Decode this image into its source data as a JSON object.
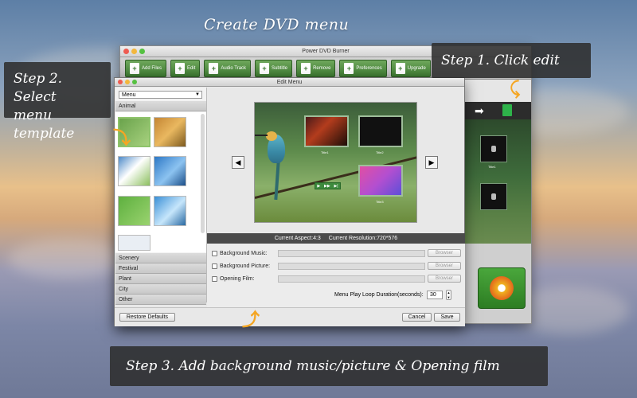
{
  "headline": "Create DVD menu",
  "callouts": {
    "step1": "Step 1. Click edit",
    "step2_line1": "Step 2. Select",
    "step2_line2": "menu template",
    "step3": "Step 3. Add background music/picture & Opening film"
  },
  "main_window": {
    "title": "Power DVD Burner",
    "toolbar": [
      {
        "label": "Add Files",
        "icon": "add-files-icon"
      },
      {
        "label": "Edit",
        "icon": "edit-icon"
      },
      {
        "label": "Audio Track",
        "icon": "audio-track-icon"
      },
      {
        "label": "Subtitle",
        "icon": "subtitle-icon"
      },
      {
        "label": "Remove",
        "icon": "remove-icon"
      },
      {
        "label": "Preferences",
        "icon": "preferences-icon"
      },
      {
        "label": "Upgrade",
        "icon": "upgrade-icon"
      }
    ],
    "thumb_label": "Title1"
  },
  "edit_dialog": {
    "title": "Edit Menu",
    "menu_select": "Menu",
    "categories_top": [
      "Animal"
    ],
    "categories_bottom": [
      "Scenery",
      "Festival",
      "Plant",
      "City",
      "Other"
    ],
    "preview_titles": [
      "Title1",
      "Title2",
      "Title3"
    ],
    "status": {
      "aspect": "Current Aspect:4:3",
      "resolution": "Current Resolution:720*576"
    },
    "options": {
      "bg_music": "Background Music:",
      "bg_picture": "Background Picture:",
      "opening_film": "Opening Film:",
      "browse": "Browser",
      "loop_label": "Menu Play Loop Duration(seconds):",
      "loop_value": "30"
    },
    "buttons": {
      "restore": "Restore Defaults",
      "cancel": "Cancel",
      "save": "Save"
    }
  },
  "colors": {
    "accent_green": "#3e7a32",
    "arrow_orange": "#f5a623"
  }
}
